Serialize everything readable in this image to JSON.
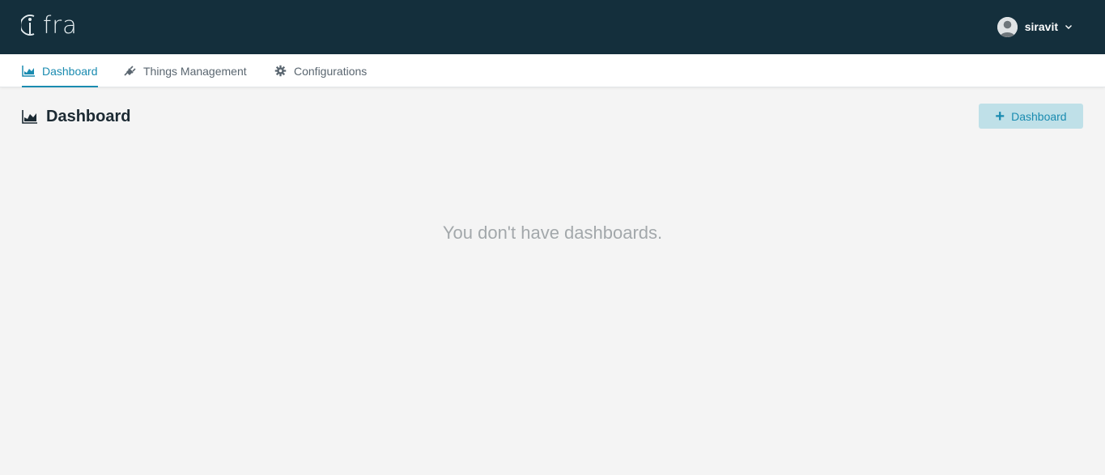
{
  "app": {
    "logo_text": "fra",
    "logo_mark_icon": "i-circle-logo"
  },
  "user": {
    "name": "siravit",
    "avatar_icon": "user-avatar-icon",
    "dropdown_icon": "chevron-down-icon"
  },
  "nav": {
    "items": [
      {
        "label": "Dashboard",
        "icon": "area-chart-icon",
        "active": true
      },
      {
        "label": "Things Management",
        "icon": "plug-icon",
        "active": false
      },
      {
        "label": "Configurations",
        "icon": "gear-icon",
        "active": false
      }
    ]
  },
  "page": {
    "title": "Dashboard",
    "title_icon": "area-chart-icon",
    "add_button_label": "Dashboard",
    "add_button_icon": "plus-icon",
    "empty_message": "You don't have dashboards."
  },
  "colors": {
    "topbar": "#142f3c",
    "accent": "#1a8bb0",
    "button_bg": "#bfe0e8",
    "page_bg": "#f4f4f4",
    "muted_text": "#a3a8ab"
  }
}
